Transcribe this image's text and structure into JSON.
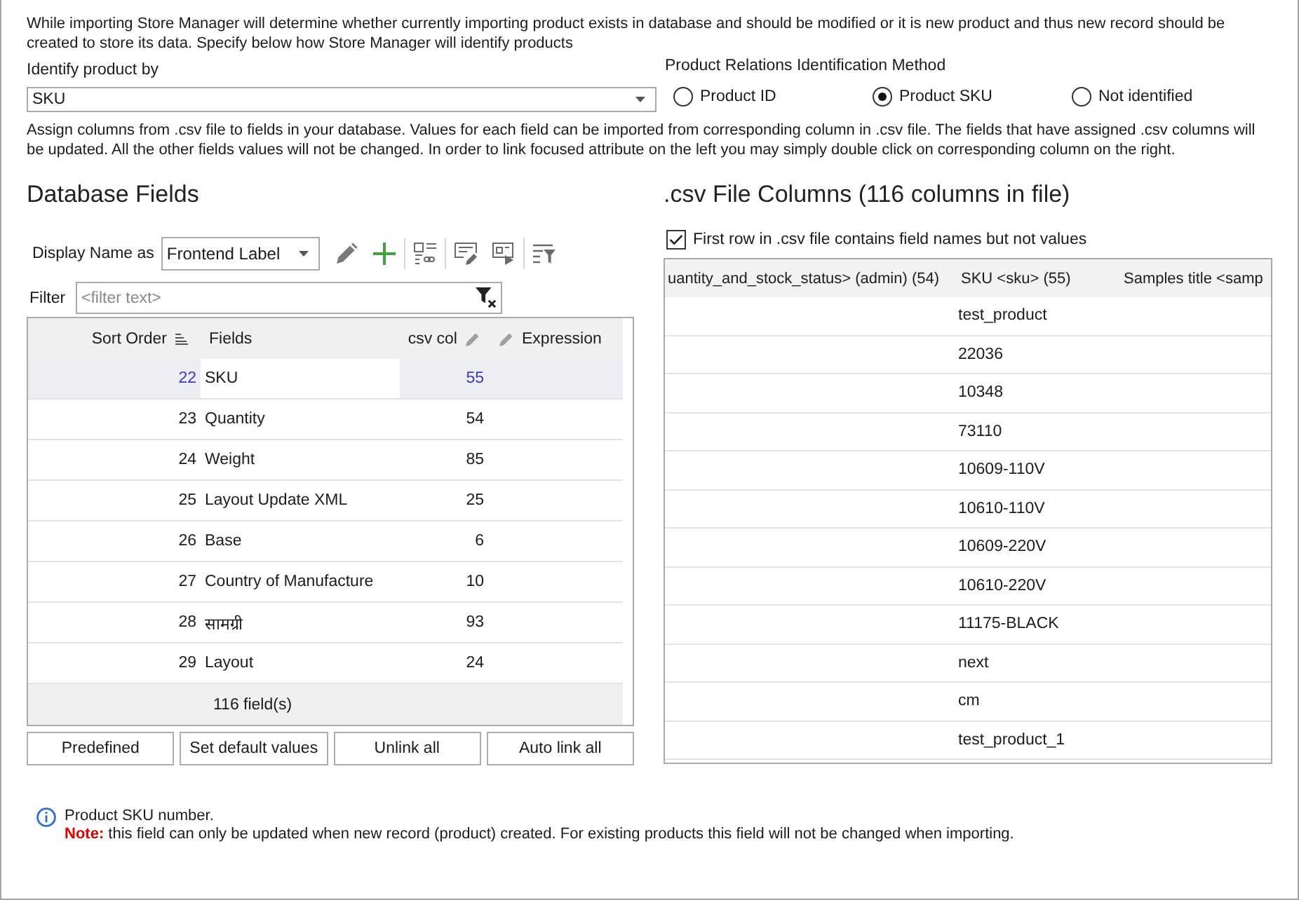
{
  "intro": "While importing Store Manager will determine whether currently importing product exists in database and should be modified or it is new product and thus new record should be created to store its data. Specify below how Store Manager will identify products",
  "identify_product": {
    "label": "Identify product by",
    "value": "SKU"
  },
  "relations": {
    "label": "Product Relations Identification Method",
    "options": [
      {
        "label": "Product ID",
        "selected": false
      },
      {
        "label": "Product SKU",
        "selected": true
      },
      {
        "label": "Not identified",
        "selected": false
      }
    ]
  },
  "assign_text": "Assign columns from .csv file to fields in your database. Values for each field can be imported from corresponding column in .csv file. The fields that have assigned .csv columns will be updated. All the other fields values will not be changed. In order to link focused attribute on the left you may simply double click on corresponding column on the right.",
  "database_fields": {
    "title": "Database Fields",
    "display_name": {
      "label": "Display Name as",
      "value": "Frontend Label"
    },
    "filter": {
      "label": "Filter",
      "placeholder": "<filter text>"
    },
    "table": {
      "columns": [
        {
          "label": "Sort Order",
          "sorted": true,
          "editable": false
        },
        {
          "label": "Fields",
          "sorted": false,
          "editable": false
        },
        {
          "label": "csv col",
          "sorted": false,
          "editable": true
        },
        {
          "label": "Expression",
          "sorted": false,
          "editable": true
        }
      ],
      "rows": [
        {
          "sort_order": "22",
          "field": "SKU",
          "csv_col": "55",
          "selected": true
        },
        {
          "sort_order": "23",
          "field": "Quantity",
          "csv_col": "54",
          "selected": false
        },
        {
          "sort_order": "24",
          "field": "Weight",
          "csv_col": "85",
          "selected": false
        },
        {
          "sort_order": "25",
          "field": "Layout Update XML",
          "csv_col": "25",
          "selected": false
        },
        {
          "sort_order": "26",
          "field": "Base",
          "csv_col": "6",
          "selected": false
        },
        {
          "sort_order": "27",
          "field": "Country of Manufacture",
          "csv_col": "10",
          "selected": false
        },
        {
          "sort_order": "28",
          "field": "सामग्री",
          "csv_col": "93",
          "selected": false
        },
        {
          "sort_order": "29",
          "field": "Layout",
          "csv_col": "24",
          "selected": false
        }
      ],
      "footer": "116 field(s)"
    },
    "buttons": [
      "Predefined",
      "Set default values",
      "Unlink all",
      "Auto link all"
    ]
  },
  "csv_columns": {
    "title": ".csv File Columns (116 columns in file)",
    "first_row": {
      "label": "First row in .csv file contains field names but not values",
      "checked": true
    },
    "table": {
      "columns": [
        {
          "label": "uantity_and_stock_status> (admin) (54)"
        },
        {
          "label": "SKU <sku> (55)",
          "values": [
            "test_product",
            "22036",
            "10348",
            "73110",
            "10609-110V",
            "10610-110V",
            "10609-220V",
            "10610-220V",
            "11175-BLACK",
            "next",
            "cm",
            "test_product_1"
          ]
        },
        {
          "label": "Samples title <samp"
        }
      ]
    }
  },
  "info": {
    "text": "Product SKU number.",
    "note": "**Note:** this field can only be updated when new record (product) created. For existing products this field will not be changed when importing."
  }
}
